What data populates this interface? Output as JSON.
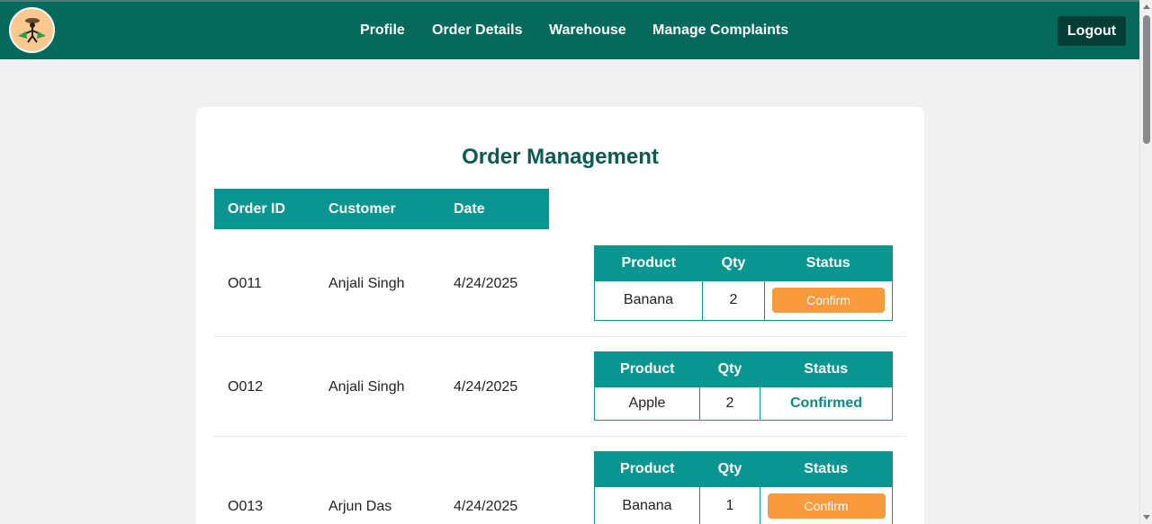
{
  "nav": {
    "links": [
      "Profile",
      "Order Details",
      "Warehouse",
      "Manage Complaints"
    ],
    "logout_label": "Logout"
  },
  "page": {
    "title": "Order Management"
  },
  "orders_table": {
    "headers": [
      "Order ID",
      "Customer",
      "Date"
    ],
    "item_headers": [
      "Product",
      "Qty",
      "Status"
    ],
    "orders": [
      {
        "id": "O011",
        "customer": "Anjali Singh",
        "date": "4/24/2025",
        "product": "Banana",
        "qty": "2",
        "status": "Confirm",
        "status_type": "button"
      },
      {
        "id": "O012",
        "customer": "Anjali Singh",
        "date": "4/24/2025",
        "product": "Apple",
        "qty": "2",
        "status": "Confirmed",
        "status_type": "text"
      },
      {
        "id": "O013",
        "customer": "Arjun Das",
        "date": "4/24/2025",
        "product": "Banana",
        "qty": "1",
        "status": "Confirm",
        "status_type": "button"
      }
    ]
  },
  "colors": {
    "navbar": "#05695b",
    "header_teal": "#0a9690",
    "confirm_orange": "#f99a3c",
    "title_green": "#0b5a52"
  }
}
